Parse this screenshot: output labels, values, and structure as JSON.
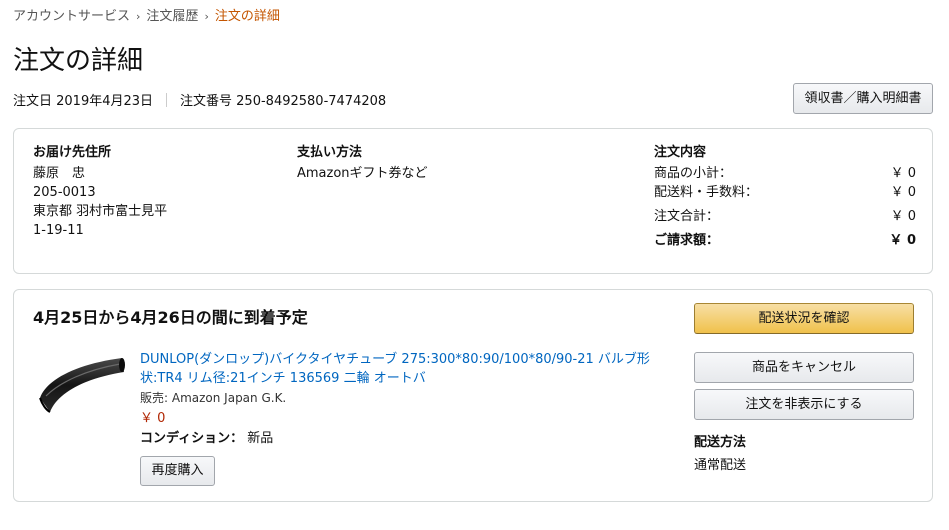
{
  "breadcrumb": {
    "items": [
      "アカウントサービス",
      "注文履歴",
      "注文の詳細"
    ],
    "separator": "›"
  },
  "page": {
    "title": "注文の詳細",
    "order_date": "注文日 2019年4月23日",
    "order_number": "注文番号 250-8492580-7474208",
    "receipt_button": "領収書／購入明細書"
  },
  "address": {
    "title": "お届け先住所",
    "name": "藤原　忠",
    "postal": "205-0013",
    "city": "東京都 羽村市富士見平",
    "street": "1-19-11"
  },
  "payment": {
    "title": "支払い方法",
    "method": "Amazonギフト券など"
  },
  "summary": {
    "title": "注文内容",
    "rows": [
      {
        "label": "商品の小計：",
        "value": "￥ 0"
      },
      {
        "label": "配送料・手数料：",
        "value": "￥ 0"
      },
      {
        "label": "注文合計：",
        "value": "￥ 0"
      },
      {
        "label": "ご請求額：",
        "value": "￥ 0"
      }
    ]
  },
  "shipment": {
    "title": "4月25日から4月26日の間に到着予定",
    "track_button": "配送状況を確認",
    "cancel_button": "商品をキャンセル",
    "hide_button": "注文を非表示にする",
    "delivery_title": "配送方法",
    "delivery_method": "通常配送"
  },
  "product": {
    "name": "DUNLOP(ダンロップ)バイクタイヤチューブ 275:300*80:90/100*80/90-21 バルブ形状:TR4 リム径:21インチ 136569 二輪 オートバ",
    "seller": "販売: Amazon Japan G.K.",
    "price": "￥ 0",
    "condition_label": "コンディション：",
    "condition_value": "新品",
    "rebuy_button": "再度購入",
    "image_icon": "tire-tube-image"
  },
  "colors": {
    "link": "#0066c0",
    "price": "#b12704",
    "current_crumb": "#c45500",
    "track_button": "#f0c14b"
  }
}
